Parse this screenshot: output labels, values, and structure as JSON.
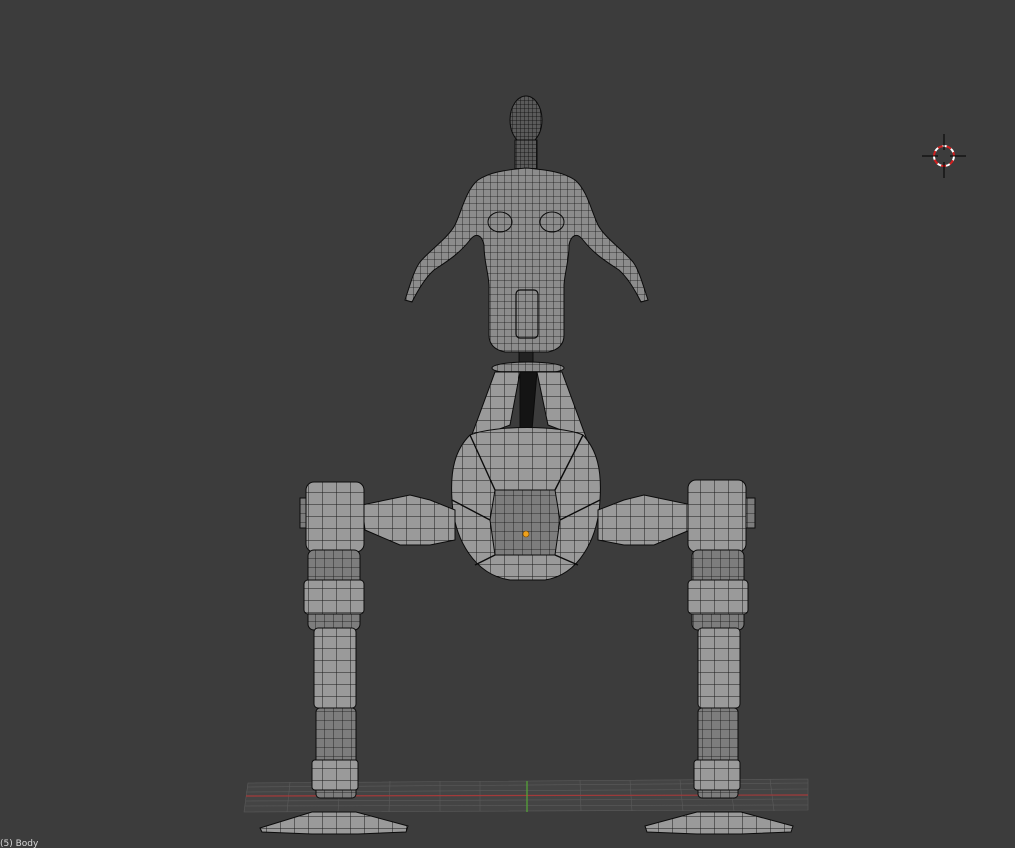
{
  "viewport": {
    "object_label": "(5) Body",
    "background": "#3c3c3c",
    "wire_color": "#0b0b0b",
    "mesh_fill": "#8a8a8a",
    "grid_color": "#5a5a5a",
    "x_axis_color": "#a33a3a",
    "y_axis_color": "#55a836",
    "origin_color": "#f0a21c",
    "cursor_color": "#d32020"
  },
  "icons": {
    "cursor": "3d-cursor-icon",
    "origin": "object-origin-icon"
  }
}
